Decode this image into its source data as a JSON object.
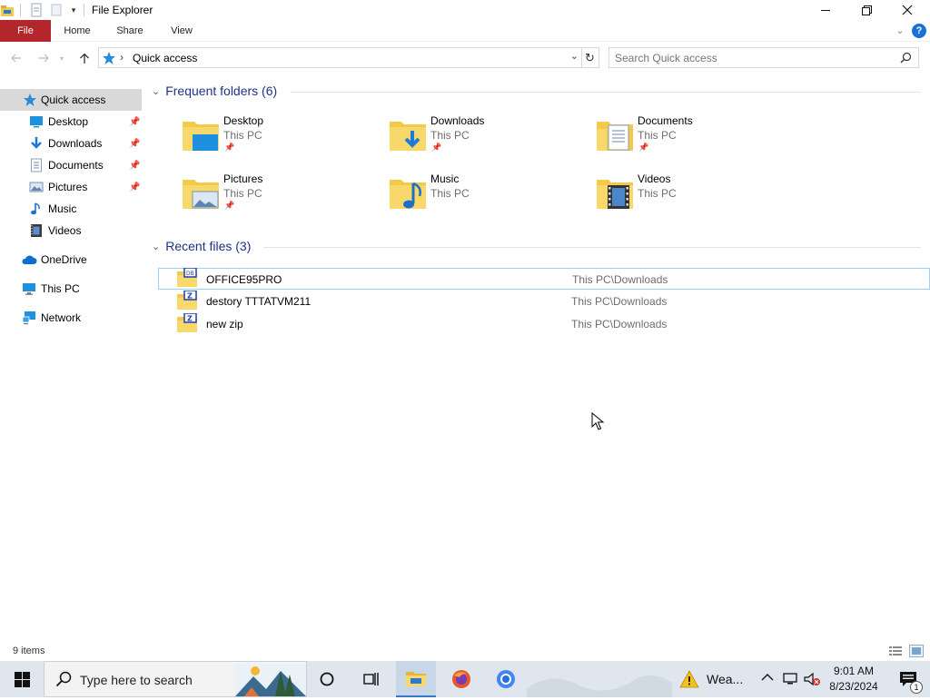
{
  "window": {
    "title": "File Explorer",
    "controls": {
      "minimize": "—",
      "restore": "❐",
      "close": "✕"
    }
  },
  "ribbon": {
    "tabs": [
      "File",
      "Home",
      "Share",
      "View"
    ],
    "help": "?"
  },
  "address_bar": {
    "location": "Quick access",
    "separator": "›",
    "refresh_icon": "↻"
  },
  "search": {
    "placeholder": "Search Quick access"
  },
  "sidebar": {
    "items": [
      {
        "label": "Quick access",
        "icon": "star-icon",
        "pinned": false,
        "selected": true
      },
      {
        "label": "Desktop",
        "icon": "desktop-icon",
        "pinned": true
      },
      {
        "label": "Downloads",
        "icon": "download-icon",
        "pinned": true
      },
      {
        "label": "Documents",
        "icon": "document-icon",
        "pinned": true
      },
      {
        "label": "Pictures",
        "icon": "picture-icon",
        "pinned": true
      },
      {
        "label": "Music",
        "icon": "music-icon",
        "pinned": false
      },
      {
        "label": "Videos",
        "icon": "video-icon",
        "pinned": false
      },
      {
        "label": "OneDrive",
        "icon": "cloud-icon",
        "pinned": false
      },
      {
        "label": "This PC",
        "icon": "computer-icon",
        "pinned": false
      },
      {
        "label": "Network",
        "icon": "network-icon",
        "pinned": false
      }
    ]
  },
  "frequent_folders": {
    "heading": "Frequent folders (6)",
    "items": [
      {
        "name": "Desktop",
        "location": "This PC",
        "pinned": true
      },
      {
        "name": "Downloads",
        "location": "This PC",
        "pinned": true
      },
      {
        "name": "Documents",
        "location": "This PC",
        "pinned": true
      },
      {
        "name": "Pictures",
        "location": "This PC",
        "pinned": true
      },
      {
        "name": "Music",
        "location": "This PC",
        "pinned": false
      },
      {
        "name": "Videos",
        "location": "This PC",
        "pinned": false
      }
    ]
  },
  "recent_files": {
    "heading": "Recent files (3)",
    "items": [
      {
        "name": "OFFICE95PRO",
        "path": "This PC\\Downloads",
        "icon": "disc-image-icon",
        "selected": true
      },
      {
        "name": "destory TTTATVM211",
        "path": "This PC\\Downloads",
        "icon": "zip-icon"
      },
      {
        "name": "new zip",
        "path": "This PC\\Downloads",
        "icon": "zip-icon"
      }
    ]
  },
  "status": {
    "item_count": "9 items"
  },
  "taskbar": {
    "search_placeholder": "Type here to search",
    "weather": "Wea...",
    "time": "9:01 AM",
    "date": "8/23/2024"
  },
  "colors": {
    "file_tab": "#b3262c",
    "group_heading": "#1e3287",
    "selection": "#cce8ff",
    "taskbar": "#dfe6ee",
    "folder_yellow": "#f3c94c"
  }
}
